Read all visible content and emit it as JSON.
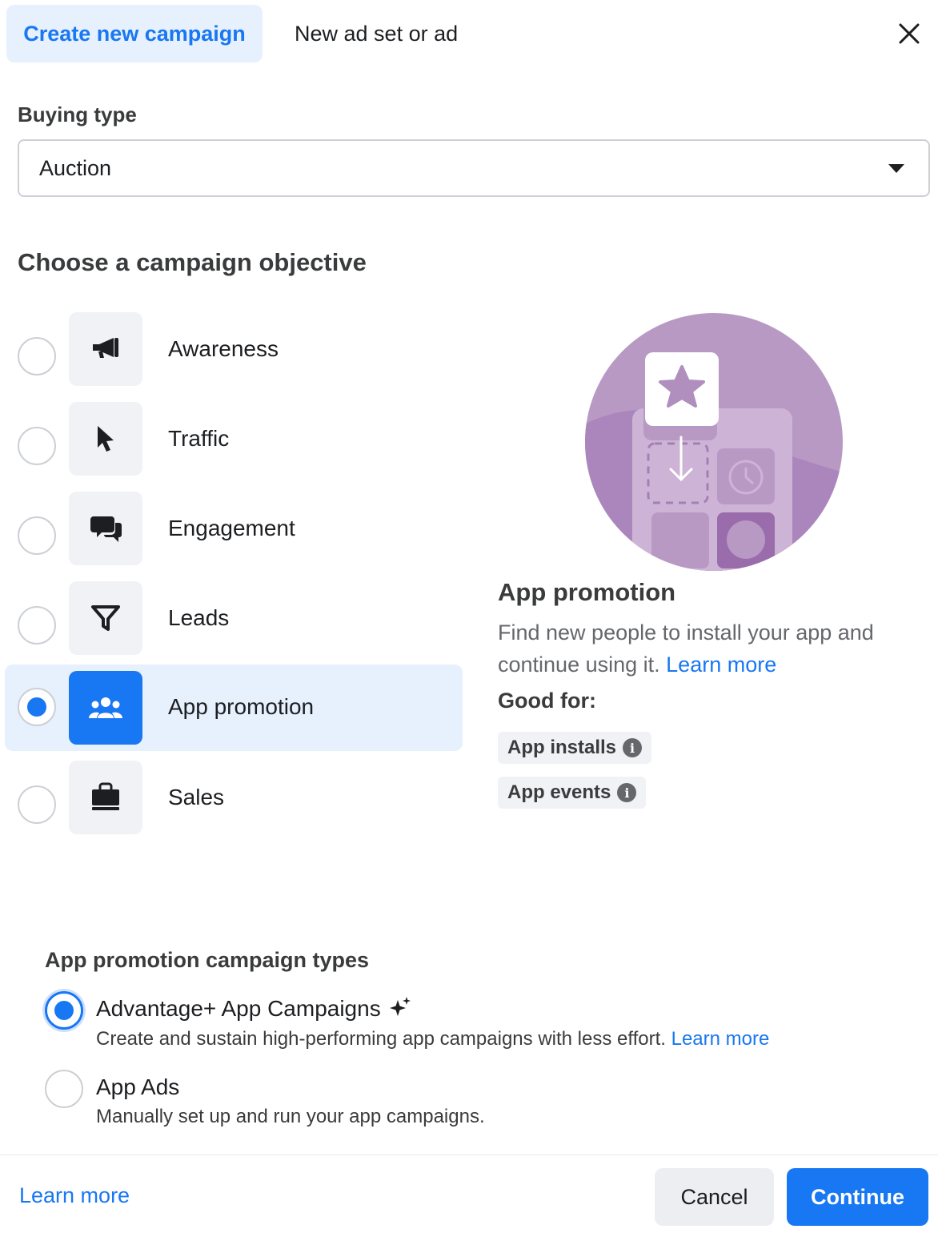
{
  "header": {
    "tabs": [
      {
        "label": "Create new campaign",
        "active": true
      },
      {
        "label": "New ad set or ad",
        "active": false
      }
    ],
    "close_icon": "close-icon"
  },
  "buying_type": {
    "label": "Buying type",
    "value": "Auction",
    "caret_icon": "caret-down-icon"
  },
  "objectives": {
    "title": "Choose a campaign objective",
    "items": [
      {
        "label": "Awareness",
        "icon": "megaphone-icon",
        "selected": false
      },
      {
        "label": "Traffic",
        "icon": "cursor-icon",
        "selected": false
      },
      {
        "label": "Engagement",
        "icon": "chat-bubbles-icon",
        "selected": false
      },
      {
        "label": "Leads",
        "icon": "filter-icon",
        "selected": false
      },
      {
        "label": "App promotion",
        "icon": "people-icon",
        "selected": true
      },
      {
        "label": "Sales",
        "icon": "shopping-bag-icon",
        "selected": false
      }
    ]
  },
  "detail": {
    "title": "App promotion",
    "description": "Find new people to install your app and continue using it.",
    "learn_more": "Learn more",
    "good_for_label": "Good for:",
    "chips": [
      {
        "label": "App installs",
        "icon": "info-icon"
      },
      {
        "label": "App events",
        "icon": "info-icon"
      }
    ]
  },
  "campaign_types": {
    "title": "App promotion campaign types",
    "options": [
      {
        "label": "Advantage+ App Campaigns",
        "description": "Create and sustain high-performing app campaigns with less effort.",
        "learn_more": "Learn more",
        "selected": true,
        "icon": "sparkle-icon"
      },
      {
        "label": "App Ads",
        "description": "Manually set up and run your app campaigns.",
        "selected": false
      }
    ]
  },
  "footer": {
    "learn_more": "Learn more",
    "cancel": "Cancel",
    "continue": "Continue"
  },
  "colors": {
    "accent": "#1877f2",
    "selected_bg": "#e7f0fd",
    "illustration": "#b899c4"
  }
}
